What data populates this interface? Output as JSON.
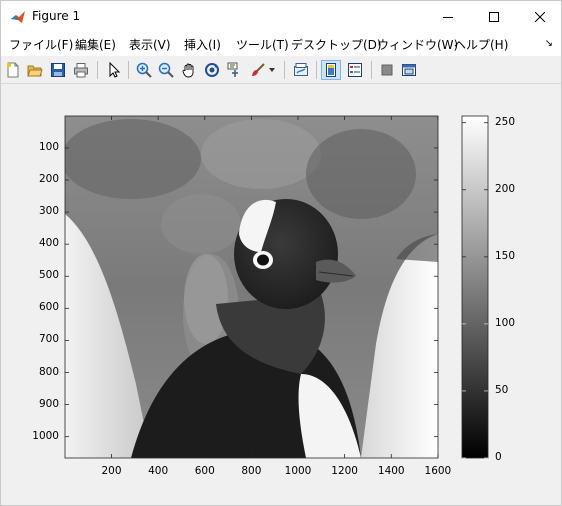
{
  "window": {
    "title": "Figure 1"
  },
  "menu": {
    "items": [
      "ファイル(F)",
      "編集(E)",
      "表示(V)",
      "挿入(I)",
      "ツール(T)",
      "デスクトップ(D)",
      "ウィンドウ(W)",
      "ヘルプ(H)"
    ],
    "more_icon": "expand-arrow-icon"
  },
  "toolbar": {
    "buttons": [
      {
        "icon": "new-figure-icon"
      },
      {
        "icon": "open-file-icon"
      },
      {
        "icon": "save-icon"
      },
      {
        "icon": "print-icon"
      },
      {
        "icon": "select-pointer-icon"
      },
      {
        "icon": "zoom-in-icon"
      },
      {
        "icon": "zoom-out-icon"
      },
      {
        "icon": "pan-hand-icon"
      },
      {
        "icon": "rotate-3d-icon"
      },
      {
        "icon": "data-cursor-icon"
      },
      {
        "icon": "brush-icon"
      },
      {
        "icon": "link-plot-icon"
      },
      {
        "icon": "colorbar-icon",
        "pressed": true
      },
      {
        "icon": "legend-icon"
      },
      {
        "icon": "hide-plot-tools-icon"
      },
      {
        "icon": "show-plot-tools-icon"
      }
    ]
  },
  "plot": {
    "colormap": "gray",
    "image_subject": "penguin",
    "x_ticks": [
      "200",
      "400",
      "600",
      "800",
      "1000",
      "1200",
      "1400",
      "1600"
    ],
    "y_ticks": [
      "100",
      "200",
      "300",
      "400",
      "500",
      "600",
      "700",
      "800",
      "900",
      "1000"
    ],
    "colorbar_ticks": [
      "0",
      "50",
      "100",
      "150",
      "200",
      "250"
    ]
  },
  "chart_data": {
    "type": "heatmap",
    "title": "",
    "xlabel": "",
    "ylabel": "",
    "xlim": [
      0.5,
      1600.5
    ],
    "ylim": [
      0.5,
      1066.5
    ],
    "x_ticks": [
      200,
      400,
      600,
      800,
      1000,
      1200,
      1400,
      1600
    ],
    "y_ticks": [
      100,
      200,
      300,
      400,
      500,
      600,
      700,
      800,
      900,
      1000
    ],
    "y_direction": "reverse",
    "colormap": "gray",
    "colorbar": {
      "range": [
        0,
        255
      ],
      "ticks": [
        0,
        50,
        100,
        150,
        200,
        250
      ]
    },
    "grid": false,
    "legend": "none"
  }
}
